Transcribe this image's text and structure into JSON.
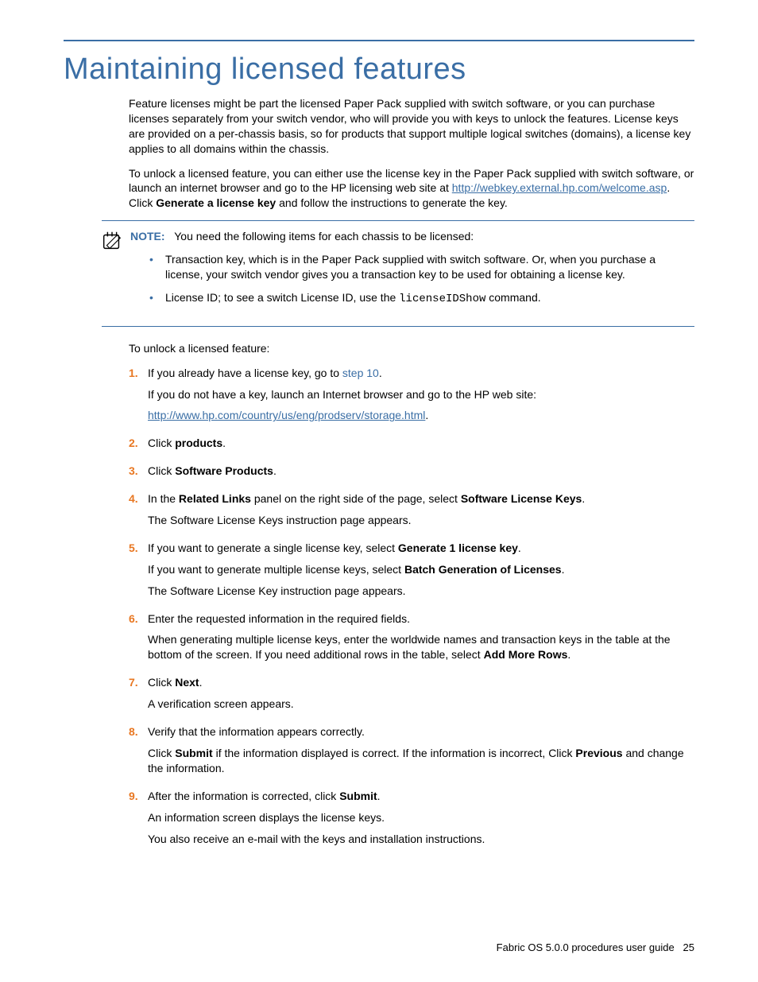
{
  "heading": "Maintaining licensed features",
  "intro_p1": "Feature licenses might be part the licensed Paper Pack supplied with switch software, or you can purchase licenses separately from your switch vendor, who will provide you with keys to unlock the features. License keys are provided on a per-chassis basis, so for products that support multiple logical switches (domains), a license key applies to all domains within the chassis.",
  "intro_p2_a": "To unlock a licensed feature, you can either use the license key in the Paper Pack supplied with switch software, or launch an internet browser and go to the HP licensing web site at ",
  "intro_p2_link": "http://webkey.external.hp.com/welcome.asp",
  "intro_p2_b": ". Click ",
  "intro_p2_bold": "Generate a license key",
  "intro_p2_c": " and follow the instructions to generate the key.",
  "note": {
    "label": "NOTE:",
    "text": "You need the following items for each chassis to be licensed:",
    "bullets": [
      "Transaction key, which is in the Paper Pack supplied with switch software. Or, when you purchase a license, your switch vendor gives you a transaction key to be used for obtaining a license key.",
      {
        "pre": "License ID; to see a switch License ID, use the ",
        "code": "licenseIDShow",
        "post": " command."
      }
    ]
  },
  "unlock_intro": "To unlock a licensed feature:",
  "steps": [
    {
      "num": "1.",
      "lines": [
        {
          "parts": [
            {
              "t": "If you already have a license key, go to "
            },
            {
              "t": "step 10",
              "cls": "step-ref"
            },
            {
              "t": "."
            }
          ]
        },
        {
          "parts": [
            {
              "t": "If you do not have a key, launch an Internet browser and go to the HP web site: "
            }
          ]
        },
        {
          "parts": [
            {
              "t": "http://www.hp.com/country/us/eng/prodserv/storage.html",
              "cls": "link"
            },
            {
              "t": "."
            }
          ]
        }
      ]
    },
    {
      "num": "2.",
      "lines": [
        {
          "parts": [
            {
              "t": "Click "
            },
            {
              "t": "products",
              "cls": "strong"
            },
            {
              "t": "."
            }
          ]
        }
      ]
    },
    {
      "num": "3.",
      "lines": [
        {
          "parts": [
            {
              "t": "Click "
            },
            {
              "t": "Software Products",
              "cls": "strong"
            },
            {
              "t": "."
            }
          ]
        }
      ]
    },
    {
      "num": "4.",
      "lines": [
        {
          "parts": [
            {
              "t": "In the "
            },
            {
              "t": "Related Links",
              "cls": "strong"
            },
            {
              "t": " panel on the right side of the page, select "
            },
            {
              "t": "Software License Keys",
              "cls": "strong"
            },
            {
              "t": "."
            }
          ]
        },
        {
          "parts": [
            {
              "t": "The Software License Keys instruction page appears."
            }
          ]
        }
      ]
    },
    {
      "num": "5.",
      "lines": [
        {
          "parts": [
            {
              "t": "If you want to generate a single license key, select "
            },
            {
              "t": "Generate 1 license key",
              "cls": "strong"
            },
            {
              "t": "."
            }
          ]
        },
        {
          "parts": [
            {
              "t": "If you want to generate multiple license keys, select "
            },
            {
              "t": "Batch Generation of Licenses",
              "cls": "strong"
            },
            {
              "t": "."
            }
          ]
        },
        {
          "parts": [
            {
              "t": "The Software License Key instruction page appears."
            }
          ]
        }
      ]
    },
    {
      "num": "6.",
      "lines": [
        {
          "parts": [
            {
              "t": "Enter the requested information in the required fields."
            }
          ]
        },
        {
          "parts": [
            {
              "t": "When generating multiple license keys, enter the worldwide names and transaction keys in the table at the bottom of the screen. If you need additional rows in the table, select "
            },
            {
              "t": "Add More Rows",
              "cls": "strong"
            },
            {
              "t": "."
            }
          ]
        }
      ]
    },
    {
      "num": "7.",
      "lines": [
        {
          "parts": [
            {
              "t": "Click "
            },
            {
              "t": "Next",
              "cls": "strong"
            },
            {
              "t": "."
            }
          ]
        },
        {
          "parts": [
            {
              "t": "A verification screen appears."
            }
          ]
        }
      ]
    },
    {
      "num": "8.",
      "lines": [
        {
          "parts": [
            {
              "t": "Verify that the information appears correctly."
            }
          ]
        },
        {
          "parts": [
            {
              "t": "Click "
            },
            {
              "t": "Submit",
              "cls": "strong"
            },
            {
              "t": " if the information displayed is correct. If the information is incorrect, Click "
            },
            {
              "t": "Previous",
              "cls": "strong"
            },
            {
              "t": " and change the information."
            }
          ]
        }
      ]
    },
    {
      "num": "9.",
      "lines": [
        {
          "parts": [
            {
              "t": "After the information is corrected, click "
            },
            {
              "t": "Submit",
              "cls": "strong"
            },
            {
              "t": "."
            }
          ]
        },
        {
          "parts": [
            {
              "t": "An information screen displays the license keys."
            }
          ]
        },
        {
          "parts": [
            {
              "t": "You also receive an e-mail with the keys and installation instructions."
            }
          ]
        }
      ]
    }
  ],
  "footer": {
    "title": "Fabric OS 5.0.0 procedures user guide",
    "page": "25"
  }
}
